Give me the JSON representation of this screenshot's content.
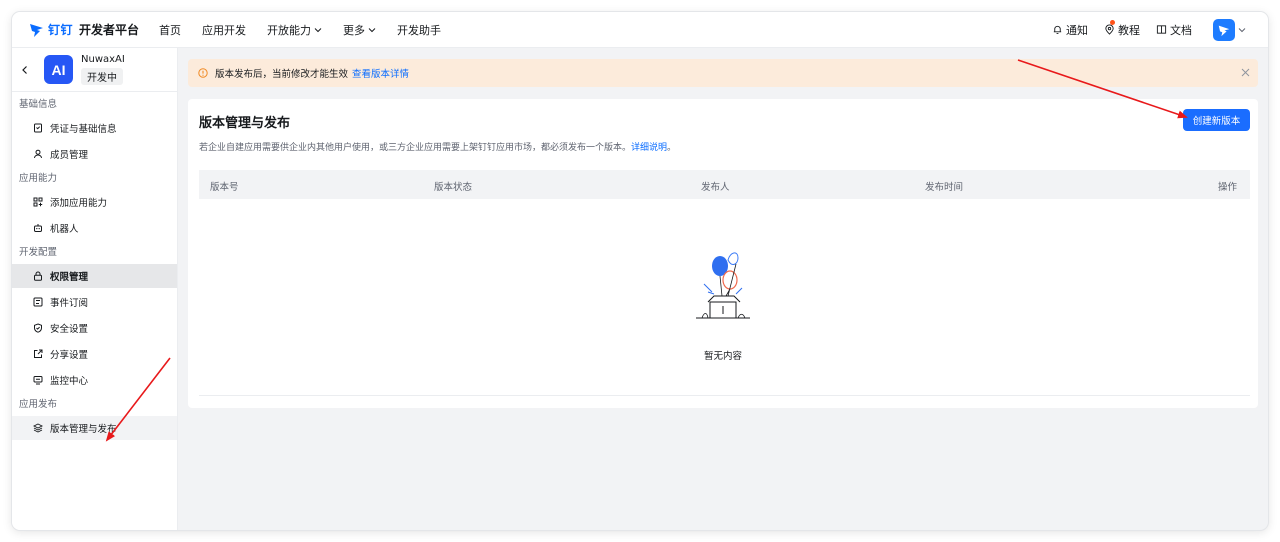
{
  "topbar": {
    "brand": "钉钉",
    "brand_sub": "开发者平台",
    "nav": [
      {
        "label": "首页"
      },
      {
        "label": "应用开发"
      },
      {
        "label": "开放能力"
      },
      {
        "label": "更多"
      },
      {
        "label": "开发助手"
      }
    ],
    "right": {
      "notify": "通知",
      "tutorial": "教程",
      "docs": "文档"
    }
  },
  "sidebar": {
    "app_name": "NuwaxAI",
    "app_status": "开发中",
    "app_logo_text": "AI",
    "groups": [
      {
        "title": "基础信息",
        "items": [
          {
            "label": "凭证与基础信息",
            "icon": "credential-icon"
          },
          {
            "label": "成员管理",
            "icon": "user-icon"
          }
        ]
      },
      {
        "title": "应用能力",
        "items": [
          {
            "label": "添加应用能力",
            "icon": "grid-plus-icon"
          },
          {
            "label": "机器人",
            "icon": "robot-icon"
          }
        ]
      },
      {
        "title": "开发配置",
        "items": [
          {
            "label": "权限管理",
            "icon": "lock-icon"
          },
          {
            "label": "事件订阅",
            "icon": "event-icon"
          },
          {
            "label": "安全设置",
            "icon": "shield-icon"
          },
          {
            "label": "分享设置",
            "icon": "share-icon"
          },
          {
            "label": "监控中心",
            "icon": "monitor-icon"
          }
        ]
      },
      {
        "title": "应用发布",
        "items": [
          {
            "label": "版本管理与发布",
            "icon": "layers-icon"
          }
        ]
      }
    ]
  },
  "notice": {
    "text": "版本发布后，当前修改才能生效",
    "link": "查看版本详情"
  },
  "main": {
    "title": "版本管理与发布",
    "desc": "若企业自建应用需要供企业内其他用户使用，或三方企业应用需要上架钉钉应用市场，都必须发布一个版本。",
    "desc_link": "详细说明",
    "desc_tail": "。",
    "create_button": "创建新版本",
    "columns": [
      "版本号",
      "版本状态",
      "发布人",
      "发布时间",
      "操作"
    ],
    "empty_text": "暂无内容"
  },
  "colors": {
    "accent": "#1a6dff",
    "notice_bg": "#fcebdb",
    "annotation_arrow": "#e8191b"
  }
}
